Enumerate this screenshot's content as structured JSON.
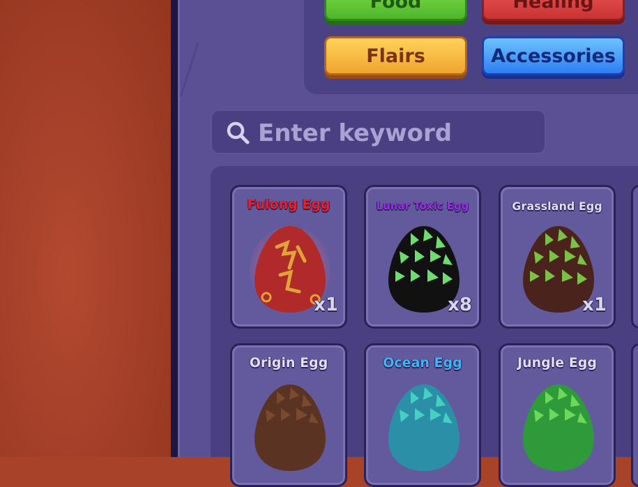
{
  "categories": {
    "food": "Food",
    "healing": "Healing",
    "flairs": "Flairs",
    "accessories": "Accessories"
  },
  "search": {
    "placeholder": "Enter keyword"
  },
  "eggs": [
    {
      "name": "Fulong Egg",
      "count": "x1",
      "name_color": "#e8202a",
      "egg_color": "#b02a2a",
      "accent": "#e0a33a"
    },
    {
      "name": "Lunar Toxic Egg",
      "count": "x8",
      "name_color": "#9a2fe0",
      "egg_color": "#111111",
      "accent": "#6fdc72"
    },
    {
      "name": "Grassland Egg",
      "count": "x1",
      "name_color": "#e2def5",
      "egg_color": "#4a241c",
      "accent": "#7ac245"
    },
    {
      "name": "Origin Egg",
      "count": "",
      "name_color": "#e2def5",
      "egg_color": "#5b3322",
      "accent": "#7a4a30"
    },
    {
      "name": "Ocean Egg",
      "count": "",
      "name_color": "#3fb5f5",
      "egg_color": "#2c8fa8",
      "accent": "#45d0c2"
    },
    {
      "name": "Jungle Egg",
      "count": "",
      "name_color": "#e2def5",
      "egg_color": "#2f9a3a",
      "accent": "#6ed85c"
    }
  ]
}
